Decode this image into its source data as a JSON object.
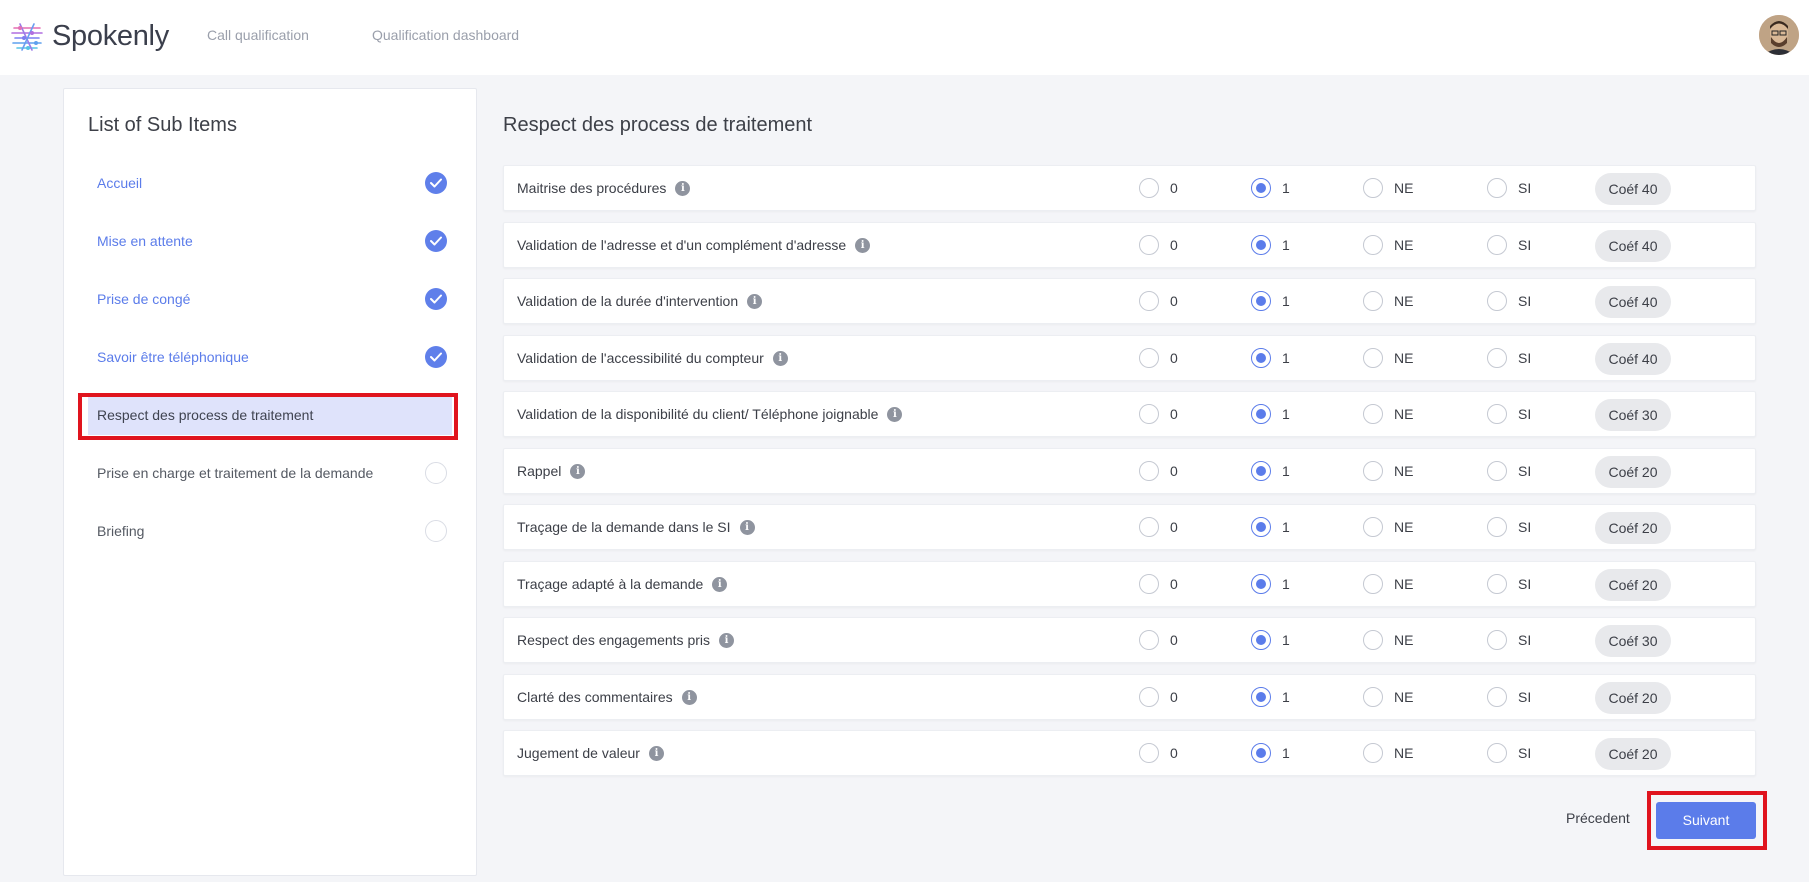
{
  "app": {
    "name": "Spokenly"
  },
  "nav": {
    "items": [
      {
        "label": "Call qualification"
      },
      {
        "label": "Qualification dashboard"
      }
    ]
  },
  "sidebar": {
    "title": "List of Sub Items",
    "items": [
      {
        "label": "Accueil",
        "status": "done"
      },
      {
        "label": "Mise en attente",
        "status": "done"
      },
      {
        "label": "Prise de congé",
        "status": "done"
      },
      {
        "label": "Savoir être téléphonique",
        "status": "done"
      },
      {
        "label": "Respect des process de traitement",
        "status": "active"
      },
      {
        "label": "Prise en charge et traitement de la demande",
        "status": "pending"
      },
      {
        "label": "Briefing",
        "status": "pending"
      }
    ]
  },
  "main": {
    "title": "Respect des process de traitement",
    "options": [
      "0",
      "1",
      "NE",
      "SI"
    ],
    "criteria": [
      {
        "label": "Maitrise des procédures",
        "selected": "1",
        "coef": "Coéf 40"
      },
      {
        "label": "Validation de l'adresse et d'un complément d'adresse",
        "selected": "1",
        "coef": "Coéf 40"
      },
      {
        "label": "Validation de la durée d'intervention",
        "selected": "1",
        "coef": "Coéf 40"
      },
      {
        "label": "Validation de l'accessibilité du compteur",
        "selected": "1",
        "coef": "Coéf 40"
      },
      {
        "label": "Validation de la disponibilité du client/ Téléphone joignable",
        "selected": "1",
        "coef": "Coéf 30"
      },
      {
        "label": "Rappel",
        "selected": "1",
        "coef": "Coéf 20"
      },
      {
        "label": "Traçage de la demande dans le SI",
        "selected": "1",
        "coef": "Coéf 20"
      },
      {
        "label": "Traçage adapté à la demande",
        "selected": "1",
        "coef": "Coéf 20"
      },
      {
        "label": "Respect des engagements pris",
        "selected": "1",
        "coef": "Coéf 30"
      },
      {
        "label": "Clarté des commentaires",
        "selected": "1",
        "coef": "Coéf 20"
      },
      {
        "label": "Jugement de valeur",
        "selected": "1",
        "coef": "Coéf 20"
      }
    ]
  },
  "footer": {
    "prev_label": "Précedent",
    "next_label": "Suivant"
  },
  "colors": {
    "accent": "#5b7cea",
    "active_item_bg": "#dfe3fb",
    "highlight": "#e0141e"
  }
}
